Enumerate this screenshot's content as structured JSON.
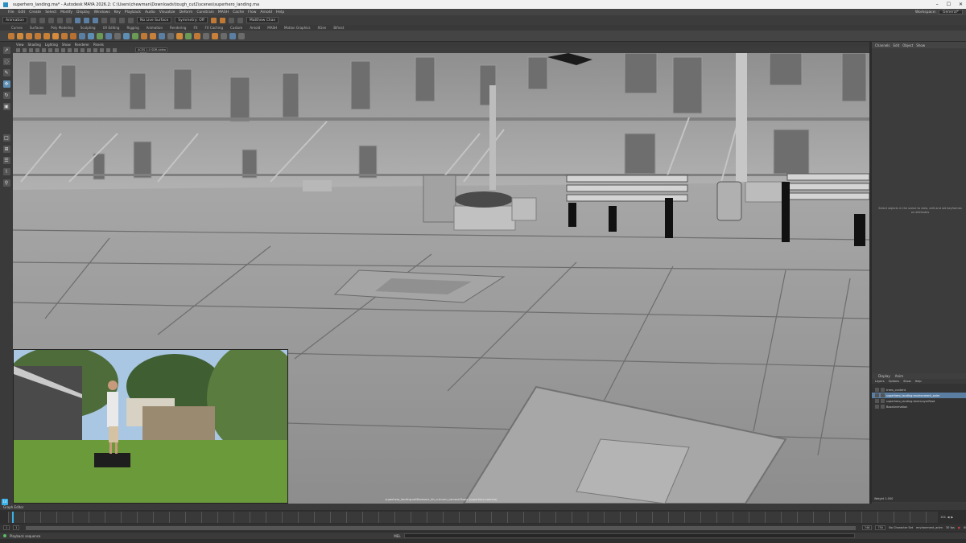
{
  "window": {
    "title": "superhero_landing.ma* - Autodesk MAYA 2026.2: C:\\Users\\chewman\\Downloads\\tough_cut2\\scenes\\superhero_landing.ma",
    "controls": [
      "–",
      "☐",
      "✕"
    ]
  },
  "menubar": {
    "items": [
      "File",
      "Edit",
      "Create",
      "Select",
      "Modify",
      "Display",
      "Windows",
      "Key",
      "Playback",
      "Audio",
      "Visualize",
      "Deform",
      "Constrain",
      "MASH",
      "Cache",
      "Flow",
      "Arnold",
      "Help"
    ],
    "workspace_label": "Workspace:",
    "workspace_value": "General*"
  },
  "statusline": {
    "mode": "Animation",
    "no_live_surface": "No Live Surface",
    "symmetry": "Symmetry: Off",
    "search": "Matthew Chan"
  },
  "shelf": {
    "tabs": [
      "Curves",
      "Surfaces",
      "Poly Modeling",
      "Sculpting",
      "UV Editing",
      "Rigging",
      "Animation",
      "Rendering",
      "FX",
      "FX Caching",
      "Custom",
      "Arnold",
      "MASH",
      "Motion Graphics",
      "XGen",
      "Bifrost"
    ]
  },
  "panel": {
    "menus": [
      "View",
      "Shading",
      "Lighting",
      "Show",
      "Renderer",
      "Panels"
    ],
    "camera_field": "ACES 1.0 SDR-video (sRGB)"
  },
  "toolbox": {
    "tools": [
      "select-tool",
      "lasso-tool",
      "paint-select-tool",
      "move-tool",
      "rotate-tool",
      "scale-tool"
    ]
  },
  "viewport": {
    "camera_label": "superhero_landing:setBrowsers_bh_cut:cam_cameraShape (superhero:camera)"
  },
  "channel_box": {
    "tabs": [
      "Channels",
      "Edit",
      "Object",
      "Show"
    ],
    "empty_message": "Select objects in the scene to view, edit and set keyframes on attributes"
  },
  "layer_editor": {
    "tabs": [
      "Display",
      "Anim"
    ],
    "menus": [
      "Layers",
      "Options",
      "Show",
      "Help"
    ],
    "layers": [
      {
        "name": "trees_content",
        "selected": false
      },
      {
        "name": "superhero_landing:environment_anim",
        "selected": true
      },
      {
        "name": "superhero_landing:AnimLayerRoot",
        "selected": false
      },
      {
        "name": "BaseAnimation",
        "selected": false
      }
    ],
    "weight_label": "Weight",
    "weight_value": "1.000"
  },
  "timeline": {
    "header": "Graph Editor",
    "current_frame": "14",
    "end_frame": "154",
    "range_start": "1",
    "range_end": "750",
    "playback_start": "1",
    "playback_end": "748",
    "character_set": "No Character Set",
    "anim_layer": "environment_anim",
    "fps": "30 fps"
  },
  "commandline": {
    "status": "Playback sequence",
    "mel_label": "MEL"
  },
  "colors": {
    "accent": "#3ab0e8",
    "selection": "#5b7fa3"
  }
}
